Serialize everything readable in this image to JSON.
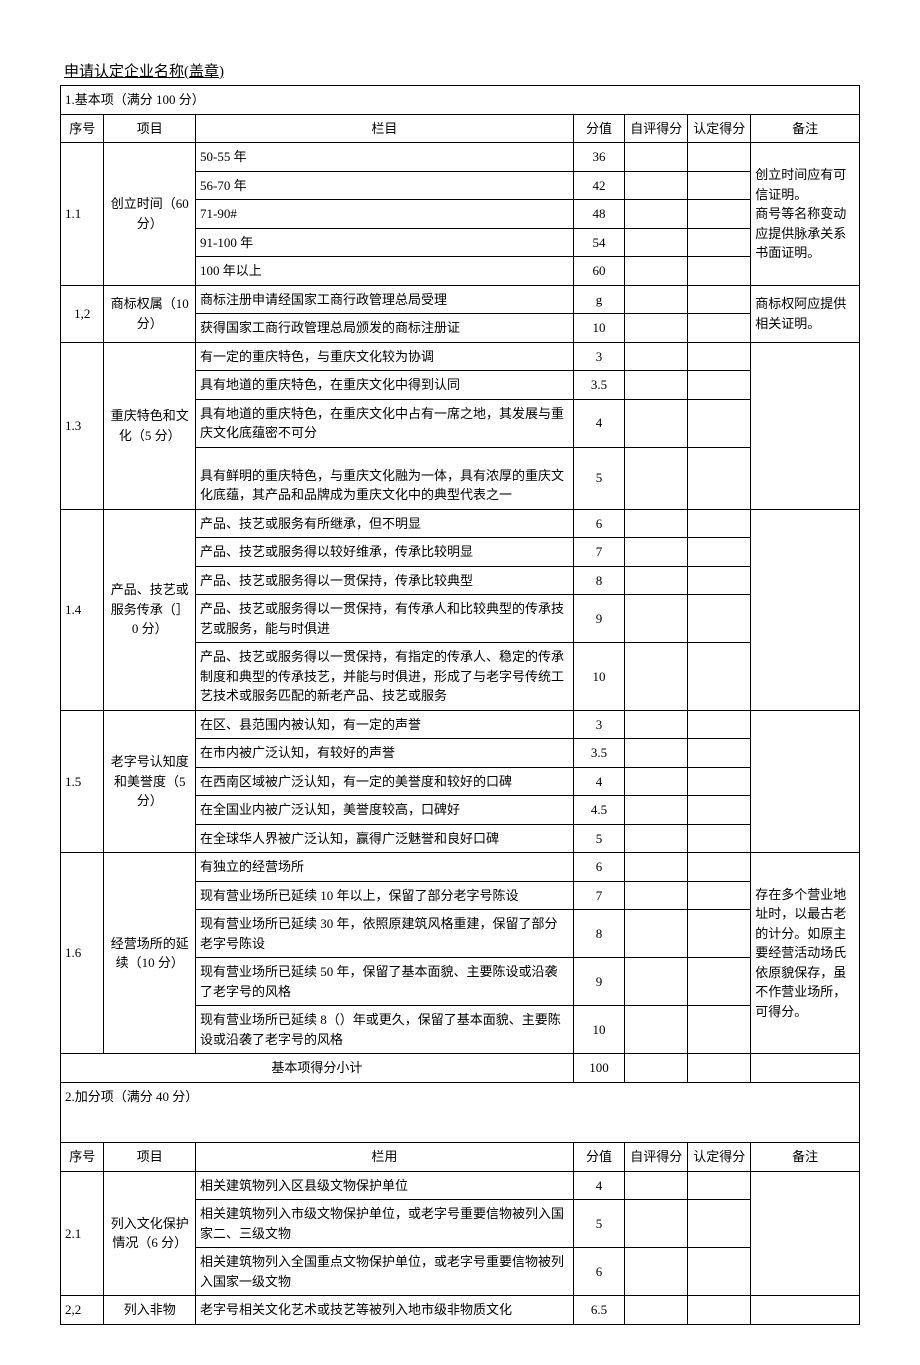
{
  "title": "申请认定企业名称(盖章)",
  "section1_header": "1.基本项（满分 100 分）",
  "hdr": {
    "xh": "序号",
    "xm": "项目",
    "lm": "栏目",
    "fz": "分值",
    "zp": "自评得分",
    "rd": "认定得分",
    "bz": "备注"
  },
  "r11": {
    "xh": "1.1",
    "xm": "创立时间（60 分）",
    "rows": [
      {
        "lm": "50-55 年",
        "fz": "36"
      },
      {
        "lm": "56-70 年",
        "fz": "42"
      },
      {
        "lm": "71-90#",
        "fz": "48"
      },
      {
        "lm": "91-100 年",
        "fz": "54"
      },
      {
        "lm": "100 年以上",
        "fz": "60"
      }
    ],
    "bz": "创立时间应有可信证明。\n商号等名称变动应提供脉承关系书面证明。"
  },
  "r12": {
    "xh": "1,2",
    "xm": "商标权属（10 分）",
    "rows": [
      {
        "lm": "商标注册申请经国家工商行政管理总局受理",
        "fz": "g"
      },
      {
        "lm": "获得国家工商行政管理总局颁发的商标注册证",
        "fz": "10"
      }
    ],
    "bz": "商标权阿应提供相关证明。"
  },
  "r13": {
    "xh": "1.3",
    "xm": "重庆特色和文化（5 分）",
    "rows": [
      {
        "lm": "有一定的重庆特色，与重庆文化较为协调",
        "fz": "3"
      },
      {
        "lm": "具有地道的重庆特色，在重庆文化中得到认同",
        "fz": "3.5"
      },
      {
        "lm": "具有地道的重庆特色，在重庆文化中占有一席之地，其发展与重庆文化底蕴密不可分",
        "fz": "4"
      },
      {
        "lm": "具有鲜明的重庆特色，与重庆文化融为一体，具有浓厚的重庆文化底蕴，其产品和品牌成为重庆文化中的典型代表之一",
        "fz": "5"
      }
    ]
  },
  "r14": {
    "xh": "1.4",
    "xm": "产品、技艺或服务传承（］0 分）",
    "rows": [
      {
        "lm": "产品、技艺或服务有所继承，但不明显",
        "fz": "6"
      },
      {
        "lm": "产品、技艺或服务得以较好维承，传承比较明显",
        "fz": "7"
      },
      {
        "lm": "产品、技艺或服务得以一贯保持，传承比较典型",
        "fz": "8"
      },
      {
        "lm": "产品、技艺或服务得以一贯保持，有传承人和比较典型的传承技艺或服务，能与时俱进",
        "fz": "9"
      },
      {
        "lm": "产品、技艺或服务得以一贯保持，有指定的传承人、稳定的传承制度和典型的传承技艺，并能与时俱进，形成了与老字号传统工艺技术或服务匹配的新老产品、技艺或服务",
        "fz": "10"
      }
    ]
  },
  "r15": {
    "xh": "1.5",
    "xm": "老字号认知度和美誉度（5 分）",
    "rows": [
      {
        "lm": "在区、县范围内被认知，有一定的声誉",
        "fz": "3"
      },
      {
        "lm": "在市内被广泛认知，有较好的声誉",
        "fz": "3.5"
      },
      {
        "lm": "在西南区域被广泛认知，有一定的美誉度和较好的口碑",
        "fz": "4"
      },
      {
        "lm": "在全国业内被广泛认知，美誉度较高，口碑好",
        "fz": "4.5"
      },
      {
        "lm": "在全球华人界被广泛认知，赢得广泛魅誉和良好口碑",
        "fz": "5"
      }
    ]
  },
  "r16": {
    "xh": "1.6",
    "xm": "经营场所的延续（10 分）",
    "rows": [
      {
        "lm": "有独立的经营场所",
        "fz": "6"
      },
      {
        "lm": "现有营业场所已延续 10 年以上，保留了部分老字号陈设",
        "fz": "7"
      },
      {
        "lm": "现有营业场所已延续 30 年，依照原建筑风格重建，保留了部分老字号陈设",
        "fz": "8"
      },
      {
        "lm": "现有营业场所已延续 50 年，保留了基本面貌、主要陈设或沿袭了老字号的风格",
        "fz": "9"
      },
      {
        "lm": "现有营业场所已延续 8（）年或更久，保留了基本面貌、主要陈设或沿袭了老字号的风格",
        "fz": "10"
      }
    ],
    "bz": "存在多个营业地址时，以最古老的计分。如原主要经营活动场氏依原貌保存，虽不作营业场所，可得分。"
  },
  "subtotal": {
    "label": "基本项得分小计",
    "fz": "100"
  },
  "section2_header": "2.加分项（满分 40 分）",
  "hdr2": {
    "xh": "序号",
    "xm": "项目",
    "lm": "栏用",
    "fz": "分值",
    "zp": "自评得分",
    "rd": "认定得分",
    "bz": "备注"
  },
  "r21": {
    "xh": "2.1",
    "xm": "列入文化保护情况（6 分）",
    "rows": [
      {
        "lm": "相关建筑物列入区县级文物保护单位",
        "fz": "4"
      },
      {
        "lm": "相关建筑物列入市级文物保护单位，或老字号重要信物被列入国家二、三级文物",
        "fz": "5"
      },
      {
        "lm": "相关建筑物列入全国重点文物保护单位，或老字号重要信物被列入国家一级文物",
        "fz": "6"
      }
    ]
  },
  "r22": {
    "xh": "2,2",
    "xm": "列入非物",
    "rows": [
      {
        "lm": "老字号相关文化艺术或技艺等被列入地市级非物质文化",
        "fz": "6.5"
      }
    ]
  }
}
